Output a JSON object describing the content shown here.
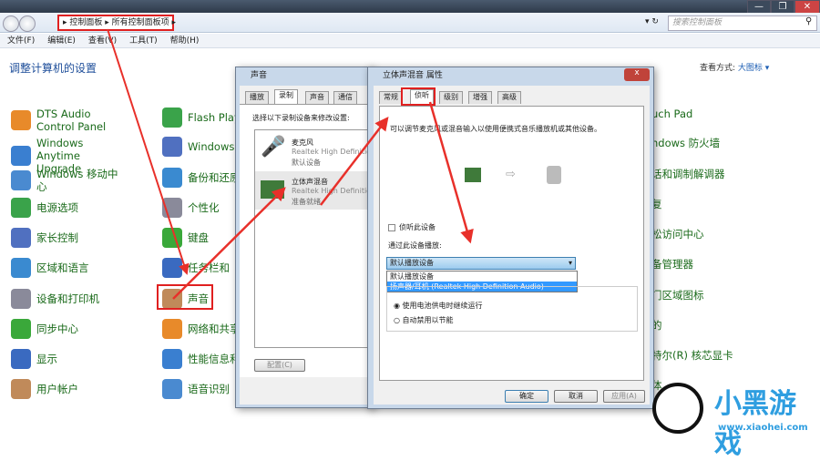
{
  "window": {
    "minimize": "—",
    "maximize": "❐",
    "close": "✕"
  },
  "address": {
    "crumbs": [
      "控制面板",
      "所有控制面板项"
    ],
    "search_placeholder": "搜索控制面板"
  },
  "menu": [
    "文件(F)",
    "编辑(E)",
    "查看(V)",
    "工具(T)",
    "帮助(H)"
  ],
  "heading": "调整计算机的设置",
  "view_by": {
    "label": "查看方式:",
    "value": "大图标 ▾"
  },
  "left_items": [
    "DTS Audio Control Panel",
    "Windows Anytime Upgrade",
    "Windows 移动中心",
    "电源选项",
    "家长控制",
    "区域和语言",
    "设备和打印机",
    "同步中心",
    "显示",
    "用户帐户"
  ],
  "mid_items": [
    "Flash Player",
    "Windows",
    "备份和还原",
    "个性化",
    "键盘",
    "任务栏和「开始」菜单",
    "声音",
    "网络和共享中心",
    "性能信息和工具",
    "语音识别"
  ],
  "right_items": [
    "uch Pad",
    "ndows 防火墙",
    "话和调制解调器",
    "复",
    "松访问中心",
    "备管理器",
    "门区域图标",
    "的",
    "特尔(R) 核芯显卡",
    "体"
  ],
  "sound_dialog": {
    "title": "声音",
    "tabs": [
      "播放",
      "录制",
      "声音",
      "通信"
    ],
    "instruction": "选择以下录制设备来修改设置:",
    "devices": [
      {
        "name": "麦克风",
        "driver": "Realtek High Definition",
        "status": "默认设备"
      },
      {
        "name": "立体声混音",
        "driver": "Realtek High Definition",
        "status": "准备就绪"
      }
    ],
    "configure": "配置(C)"
  },
  "props_dialog": {
    "title": "立体声混音 属性",
    "close": "x",
    "tabs": [
      "常规",
      "侦听",
      "级别",
      "增强",
      "高级"
    ],
    "description": "可以调节麦克风或混音输入以使用便携式音乐播放机或其他设备。",
    "listen_checkbox": "侦听此设备",
    "playback_label": "通过此设备播放:",
    "dropdown_value": "默认播放设备",
    "dropdown_options": [
      "默认播放设备",
      "扬声器/耳机 (Realtek High Definition Audio)"
    ],
    "radio1": "使用电池供电时继续运行",
    "radio2": "自动禁用以节能",
    "ok": "确定",
    "cancel": "取消",
    "apply": "应用(A)"
  },
  "watermark": {
    "text": "小黑游戏",
    "url": "www.xiaohei.com"
  }
}
